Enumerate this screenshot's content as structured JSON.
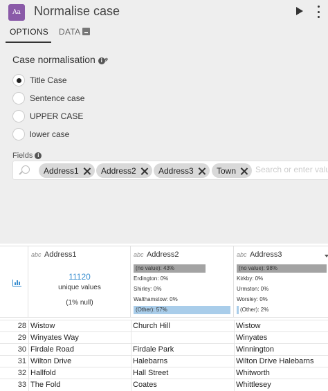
{
  "header": {
    "app_icon_text": "Aa",
    "title": "Normalise case",
    "play_icon": "play-icon",
    "menu_icon": "kebab-menu-icon"
  },
  "tabs": [
    {
      "label": "OPTIONS",
      "active": true
    },
    {
      "label": "DATA",
      "active": false,
      "icon": "database-icon"
    }
  ],
  "case_section": {
    "title": "Case normalisation",
    "options": [
      {
        "label": "Title Case",
        "selected": true
      },
      {
        "label": "Sentence case",
        "selected": false
      },
      {
        "label": "UPPER CASE",
        "selected": false
      },
      {
        "label": "lower case",
        "selected": false
      }
    ]
  },
  "fields": {
    "label": "Fields",
    "chips": [
      "Address1",
      "Address2",
      "Address3",
      "Town"
    ],
    "placeholder": "Search or enter value"
  },
  "grid": {
    "type_prefix": "abc",
    "columns": [
      {
        "name": "Address1",
        "unique_count": "11120",
        "unique_label": "unique values",
        "null_note": "(1% null)"
      },
      {
        "name": "Address2",
        "stats": [
          "(no value): 43%",
          "Erdington: 0%",
          "Shirley: 0%",
          "Walthamstow: 0%",
          "(Other): 57%"
        ],
        "bars": [
          0.43,
          0,
          0,
          0,
          0.57
        ]
      },
      {
        "name": "Address3",
        "stats": [
          "(no value): 98%",
          "Kirkby: 0%",
          "Urmston: 0%",
          "Worsley: 0%",
          "(Other): 2%"
        ],
        "bars": [
          0.98,
          0,
          0,
          0,
          0.02
        ]
      }
    ],
    "rows": [
      {
        "n": "28",
        "a1": "Wistow",
        "a2": "Church Hill",
        "a3": "Wistow"
      },
      {
        "n": "29",
        "a1": "Winyates Way",
        "a2": "",
        "a3": "Winyates"
      },
      {
        "n": "30",
        "a1": "Firdale Road",
        "a2": "Firdale Park",
        "a3": "Winnington"
      },
      {
        "n": "31",
        "a1": "Wilton Drive",
        "a2": "Halebarns",
        "a3": "Wilton Drive Halebarns"
      },
      {
        "n": "32",
        "a1": "Hallfold",
        "a2": "Hall Street",
        "a3": "Whitworth"
      },
      {
        "n": "33",
        "a1": "The Fold",
        "a2": "Coates",
        "a3": "Whittlesey"
      }
    ]
  },
  "colors": {
    "panel_bg": "#eeeeee",
    "accent": "#3a8fd0",
    "app_icon_bg": "#8a5aa8",
    "no_value_bar": "#a3a3a3",
    "other_bar": "#a9cdea"
  }
}
